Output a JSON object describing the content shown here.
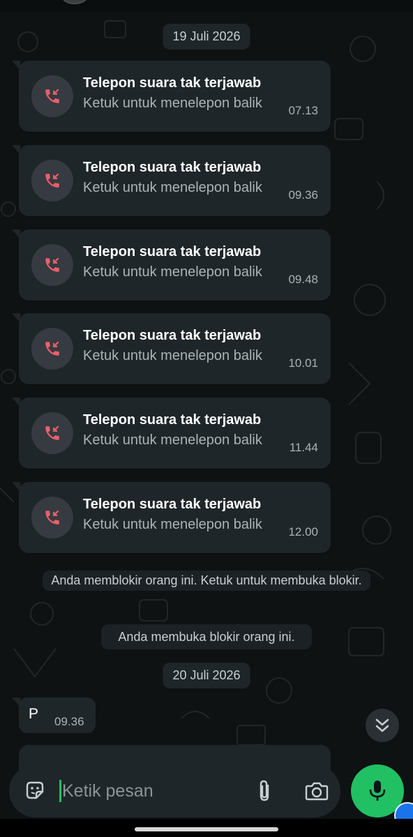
{
  "dates": [
    "19 Juli 2026",
    "20 Juli 2026"
  ],
  "missed_calls": [
    {
      "title": "Telepon suara tak terjawab",
      "subtitle": "Ketuk untuk menelepon balik",
      "time": "07.13"
    },
    {
      "title": "Telepon suara tak terjawab",
      "subtitle": "Ketuk untuk menelepon balik",
      "time": "09.36"
    },
    {
      "title": "Telepon suara tak terjawab",
      "subtitle": "Ketuk untuk menelepon balik",
      "time": "09.48"
    },
    {
      "title": "Telepon suara tak terjawab",
      "subtitle": "Ketuk untuk menelepon balik",
      "time": "10.01"
    },
    {
      "title": "Telepon suara tak terjawab",
      "subtitle": "Ketuk untuk menelepon balik",
      "time": "11.44"
    },
    {
      "title": "Telepon suara tak terjawab",
      "subtitle": "Ketuk untuk menelepon balik",
      "time": "12.00"
    }
  ],
  "system_messages": {
    "blocked": "Anda memblokir orang ini. Ketuk untuk membuka blokir.",
    "unblocked": "Anda membuka blokir orang ini."
  },
  "message": {
    "text": "P",
    "time": "09.36"
  },
  "composer": {
    "placeholder": "Ketik pesan"
  },
  "icons": {
    "missed_call": "missed-call-icon",
    "scroll_down": "double-chevron-down-icon",
    "emoji": "sticker-icon",
    "attach": "paperclip-icon",
    "camera": "camera-icon",
    "mic": "microphone-icon"
  },
  "colors": {
    "background": "#0e1213",
    "bubble": "#1f2629",
    "missed_call_red": "#f15c6d",
    "accent_green": "#21c063"
  }
}
